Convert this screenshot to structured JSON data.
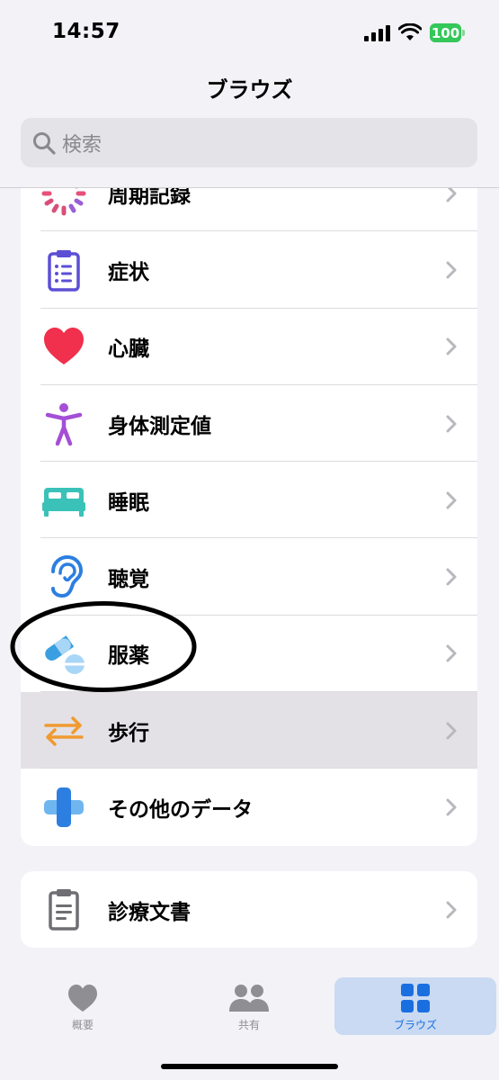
{
  "status_bar": {
    "time": "14:57",
    "battery": "100"
  },
  "nav": {
    "title": "ブラウズ"
  },
  "search": {
    "placeholder": "検索"
  },
  "categories": [
    {
      "label": "周期記録",
      "icon": "cycle-tracking-icon"
    },
    {
      "label": "症状",
      "icon": "clipboard-list-icon"
    },
    {
      "label": "心臓",
      "icon": "heart-icon"
    },
    {
      "label": "身体測定値",
      "icon": "body-measurements-icon"
    },
    {
      "label": "睡眠",
      "icon": "bed-icon"
    },
    {
      "label": "聴覚",
      "icon": "ear-icon"
    },
    {
      "label": "服薬",
      "icon": "pills-icon"
    },
    {
      "label": "歩行",
      "icon": "walking-arrows-icon"
    },
    {
      "label": "その他のデータ",
      "icon": "plus-cross-icon"
    }
  ],
  "documents": {
    "label": "診療文書",
    "icon": "document-clipboard-icon"
  },
  "tabs": [
    {
      "label": "概要",
      "icon": "heart-tab-icon",
      "active": false
    },
    {
      "label": "共有",
      "icon": "people-icon",
      "active": false
    },
    {
      "label": "ブラウズ",
      "icon": "grid-icon",
      "active": true
    }
  ],
  "colors": {
    "accent": "#1a6fe0",
    "battery": "#34c759",
    "heart": "#f0304c",
    "symptoms": "#5b4fd6",
    "body": "#a44fd6",
    "sleep": "#3ac2b8",
    "hearing": "#2c7fe0",
    "medication": "#3a9fe0",
    "walking": "#f09a30",
    "other": "#2c7fe0"
  }
}
